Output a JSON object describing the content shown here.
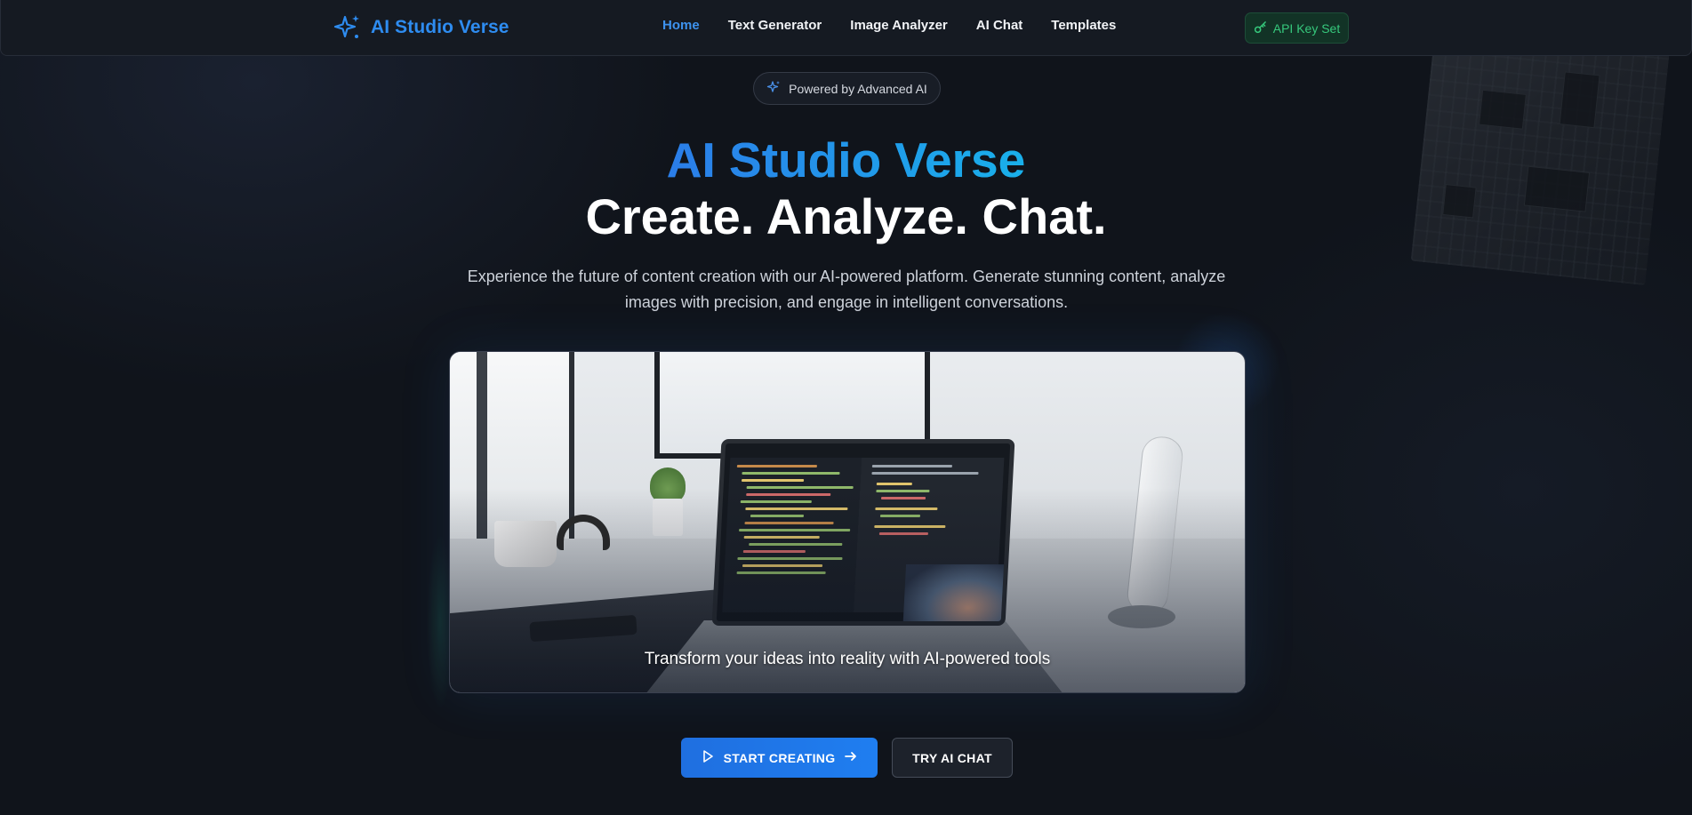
{
  "navbar": {
    "brand": "AI Studio Verse",
    "links": [
      "Home",
      "Text Generator",
      "Image Analyzer",
      "AI Chat",
      "Templates"
    ],
    "active_link": "Home",
    "api_badge": "API Key Set"
  },
  "hero": {
    "pill": "Powered by Advanced AI",
    "title": "AI Studio Verse",
    "subtitle": "Create. Analyze. Chat.",
    "description": "Experience the future of content creation with our AI-powered platform. Generate stunning content, analyze images with precision, and engage in intelligent conversations.",
    "image_caption": "Transform your ideas into reality with AI-powered tools",
    "primary_button": "START CREATING",
    "secondary_button": "TRY AI CHAT"
  },
  "colors": {
    "accent": "#2e8cf0",
    "background": "#10141b",
    "success": "#36c87c"
  },
  "icons": {
    "brand": "sparkles-icon",
    "api_badge": "key-icon",
    "pill": "sparkles-icon",
    "primary_button_left": "play-icon",
    "primary_button_right": "arrow-right-icon"
  }
}
